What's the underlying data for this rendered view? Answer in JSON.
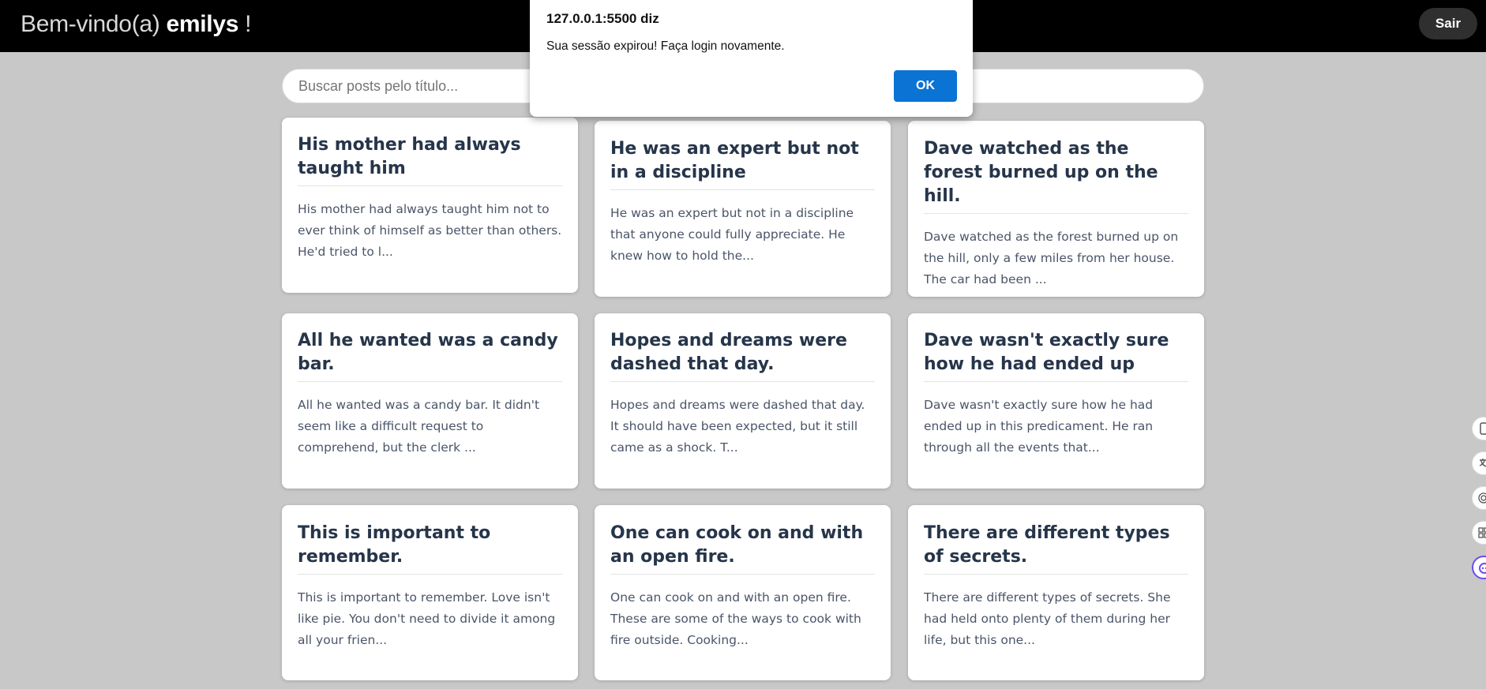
{
  "header": {
    "greeting": "Bem-vindo(a)",
    "username": "emilys",
    "exclamation": "!",
    "logout_label": "Sair"
  },
  "search": {
    "placeholder": "Buscar posts pelo título..."
  },
  "posts": [
    {
      "title": "His mother had always taught him",
      "excerpt": "His mother had always taught him not to ever think of himself as better than others. He'd tried to l..."
    },
    {
      "title": "He was an expert but not in a discipline",
      "excerpt": "He was an expert but not in a discipline that anyone could fully appreciate. He knew how to hold the..."
    },
    {
      "title": "Dave watched as the forest burned up on the hill.",
      "excerpt": "Dave watched as the forest burned up on the hill, only a few miles from her house. The car had been ..."
    },
    {
      "title": "All he wanted was a candy bar.",
      "excerpt": "All he wanted was a candy bar. It didn't seem like a difficult request to comprehend, but the clerk ..."
    },
    {
      "title": "Hopes and dreams were dashed that day.",
      "excerpt": "Hopes and dreams were dashed that day. It should have been expected, but it still came as a shock. T..."
    },
    {
      "title": "Dave wasn't exactly sure how he had ended up",
      "excerpt": "Dave wasn't exactly sure how he had ended up in this predicament. He ran through all the events that..."
    },
    {
      "title": "This is important to remember.",
      "excerpt": "This is important to remember. Love isn't like pie. You don't need to divide it among all your frien..."
    },
    {
      "title": "One can cook on and with an open fire.",
      "excerpt": "One can cook on and with an open fire. These are some of the ways to cook with fire outside. Cooking..."
    },
    {
      "title": "There are different types of secrets.",
      "excerpt": "There are different types of secrets. She had held onto plenty of them during her life, but this one..."
    }
  ],
  "dialog": {
    "origin": "127.0.0.1:5500 diz",
    "message": "Sua sessão expirou! Faça login novamente.",
    "ok_label": "OK"
  },
  "side_extensions": [
    "phone-icon",
    "translate-icon",
    "fingerprint-icon",
    "grid-icon",
    "assistant-icon"
  ]
}
